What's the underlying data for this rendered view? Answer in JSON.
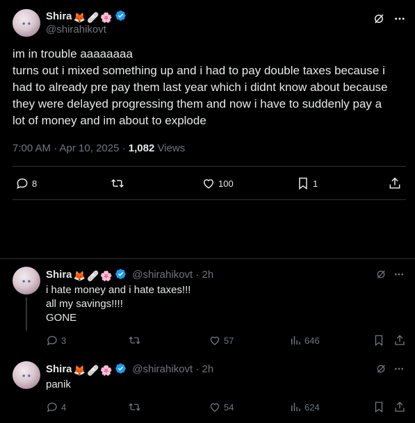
{
  "main_post": {
    "display_name": "Shira",
    "badges": [
      "🦊",
      "🩹",
      "🌸"
    ],
    "handle": "@shirahikovt",
    "text_lines": [
      "im in trouble aaaaaaaa",
      "turns out i mixed something up and i had to pay double taxes because i",
      "had to already pre pay them last year which i didnt know about because",
      "they were delayed progressing them and now i have to suddenly pay a",
      "lot of money and im about to explode"
    ],
    "time": "7:00 AM · Apr 10, 2025 ·",
    "views_count": "1,082",
    "views_label": "Views",
    "replies": "8",
    "likes": "100",
    "bookmarks": "1"
  },
  "replies": [
    {
      "display_name": "Shira",
      "badges": [
        "🦊",
        "🩹",
        "🌸"
      ],
      "handle": "@shirahikovt · 2h",
      "text_lines": [
        "i hate money and i hate taxes!!!",
        "all my savings!!!!",
        "GONE"
      ],
      "replies": "3",
      "likes": "57",
      "views": "646"
    },
    {
      "display_name": "Shira",
      "badges": [
        "🦊",
        "🩹",
        "🌸"
      ],
      "handle": "@shirahikovt · 2h",
      "text_lines": [
        "panik"
      ],
      "replies": "4",
      "likes": "54",
      "views": "624"
    }
  ],
  "colors": {
    "background": "#000000",
    "text": "#e7e9ea",
    "muted": "#71767b",
    "divider": "#2f3336",
    "verified": "#1d9bf0"
  }
}
